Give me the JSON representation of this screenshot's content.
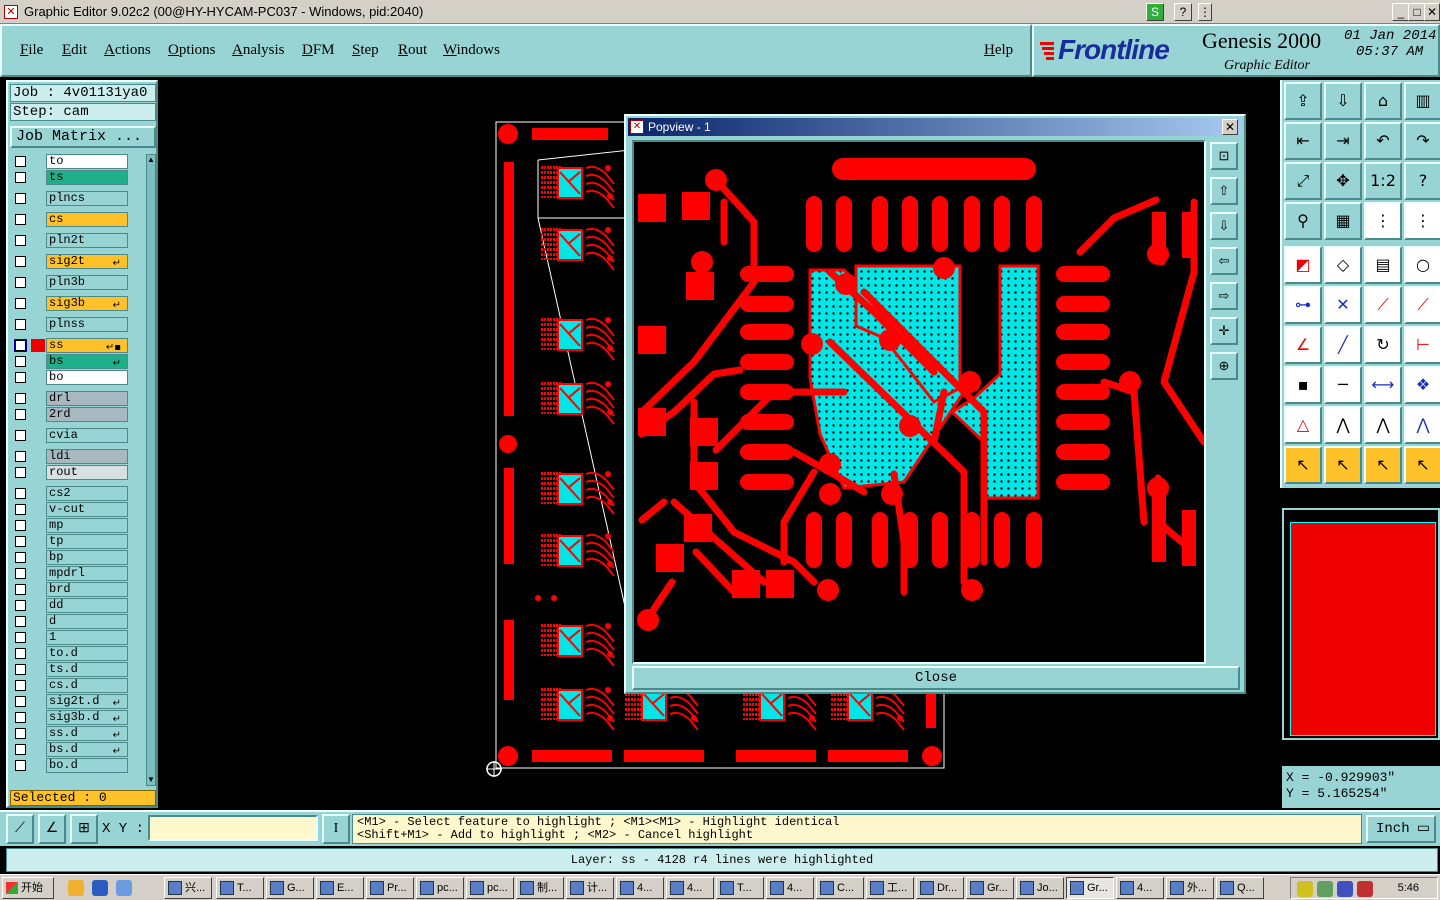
{
  "window": {
    "title": "Graphic Editor 9.02c2 (00@HY-HYCAM-PC037 - Windows, pid:2040)"
  },
  "menu": {
    "items": [
      "File",
      "Edit",
      "Actions",
      "Options",
      "Analysis",
      "DFM",
      "Step",
      "Rout",
      "Windows"
    ],
    "help": "Help"
  },
  "brand": {
    "logo": "Frontline",
    "product": "Genesis 2000",
    "subtitle": "Graphic Editor",
    "date": "01 Jan 2014",
    "time": "05:37 AM"
  },
  "job": {
    "job_line": "Job : 4v01131ya0",
    "step_line": "Step: cam",
    "matrix_button": "Job Matrix ..."
  },
  "layers": [
    {
      "name": "to",
      "color": "#ffffff"
    },
    {
      "name": "ts",
      "color": "#1fb08a"
    },
    {
      "name": "plncs",
      "color": "#98d4d4"
    },
    {
      "name": "cs",
      "color": "#ffc12a"
    },
    {
      "name": "pln2t",
      "color": "#98d4d4"
    },
    {
      "name": "sig2t",
      "color": "#ffc12a",
      "flag": "↵"
    },
    {
      "name": "pln3b",
      "color": "#98d4d4"
    },
    {
      "name": "sig3b",
      "color": "#ffc12a",
      "flag": "↵"
    },
    {
      "name": "plnss",
      "color": "#98d4d4"
    },
    {
      "name": "ss",
      "color": "#ffc12a",
      "flag": "↵▪",
      "active": true
    },
    {
      "name": "bs",
      "color": "#1fb08a",
      "flag": "↵"
    },
    {
      "name": "bo",
      "color": "#ffffff"
    },
    {
      "name": "drl",
      "color": "#a8b8c0"
    },
    {
      "name": "2rd",
      "color": "#a8b8c0"
    },
    {
      "name": "cvia",
      "color": "#98d4d4"
    },
    {
      "name": "ldi",
      "color": "#a8b8c0"
    },
    {
      "name": "rout",
      "color": "#d8e0e0"
    },
    {
      "name": "cs2",
      "color": "#98d4d4"
    },
    {
      "name": "v-cut",
      "color": "#98d4d4"
    },
    {
      "name": "mp",
      "color": "#98d4d4"
    },
    {
      "name": "tp",
      "color": "#98d4d4"
    },
    {
      "name": "bp",
      "color": "#98d4d4"
    },
    {
      "name": "mpdrl",
      "color": "#98d4d4"
    },
    {
      "name": "brd",
      "color": "#98d4d4"
    },
    {
      "name": "dd",
      "color": "#98d4d4"
    },
    {
      "name": "d",
      "color": "#98d4d4"
    },
    {
      "name": "1",
      "color": "#98d4d4"
    },
    {
      "name": "to.d",
      "color": "#98d4d4"
    },
    {
      "name": "ts.d",
      "color": "#98d4d4"
    },
    {
      "name": "cs.d",
      "color": "#98d4d4"
    },
    {
      "name": "sig2t.d",
      "color": "#98d4d4",
      "flag": "↵"
    },
    {
      "name": "sig3b.d",
      "color": "#98d4d4",
      "flag": "↵"
    },
    {
      "name": "ss.d",
      "color": "#98d4d4",
      "flag": "↵"
    },
    {
      "name": "bs.d",
      "color": "#98d4d4",
      "flag": "↵"
    },
    {
      "name": "bo.d",
      "color": "#98d4d4"
    }
  ],
  "selected": "Selected : 0",
  "popview": {
    "title": "Popview - 1",
    "close_label": "Close",
    "tools": [
      "zoom-home-icon",
      "pan-up-icon",
      "pan-down-icon",
      "pan-left-icon",
      "pan-right-icon",
      "zoom-in-icon",
      "zoom-out-icon"
    ]
  },
  "tools": {
    "rows": [
      [
        "open-icon",
        "save-icon",
        "home-icon",
        "window-split-icon"
      ],
      [
        "import-icon",
        "export-icon",
        "undo-icon",
        "redo-icon"
      ],
      [
        "fit-icon",
        "center-icon",
        "scale-1-2-icon",
        "help-icon"
      ],
      [
        "snap-icon",
        "grid-icon",
        "layers-icon",
        "layers-red-icon"
      ],
      [
        "pad-icon",
        "polygon-icon",
        "ruler-icon",
        "circle-icon"
      ],
      [
        "net-icon",
        "cross-icon",
        "connect-icon",
        "link-icon"
      ],
      [
        "angle-icon",
        "line-icon",
        "arc-icon",
        "text-icon"
      ],
      [
        "symbol-icon",
        "minus-icon",
        "measure-icon",
        "shapes-icon"
      ],
      [
        "triangle-icon",
        "vertex-icon",
        "peak-icon",
        "peak-blue-icon"
      ],
      [
        "pointer-icon",
        "pointer-box-icon",
        "pointer-circle-icon",
        "pointer-path-icon"
      ]
    ],
    "labels": {
      "scale-1-2-icon": "1:2",
      "help-icon": "?"
    }
  },
  "coords": {
    "x": "X = -0.929903\"",
    "y": "Y = 5.165254\""
  },
  "bottom": {
    "xy_label": "X Y :",
    "xy_value": "",
    "prompt_line1": "<M1> - Select feature to highlight ; <M1><M1> - Highlight identical",
    "prompt_line2": "<Shift+M1> - Add to highlight ; <M2> - Cancel highlight",
    "units": "Inch",
    "status": "Layer: ss - 4128 r4 lines were highlighted"
  },
  "taskbar": {
    "start": "开始",
    "tasks": [
      "兴...",
      "T...",
      "G...",
      "E...",
      "Pr...",
      "pc...",
      "pc...",
      "制...",
      "计...",
      "4...",
      "4...",
      "T...",
      "4...",
      "C...",
      "工...",
      "Dr...",
      "Gr...",
      "Jo...",
      "Gr...",
      "4...",
      "外...",
      "Q..."
    ],
    "clock": "5:46"
  },
  "colors": {
    "panel": "#98d4d4",
    "copper": "#ff0000",
    "highlight": "#00e5e5",
    "selected": "#ffc12a"
  }
}
